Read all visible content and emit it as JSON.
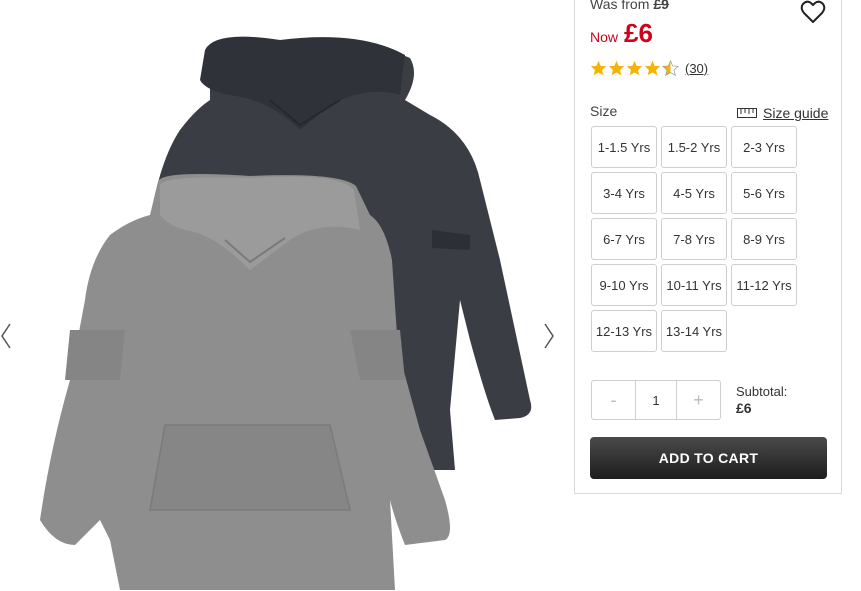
{
  "product": {
    "image_alt": "Two hooded long-sleeve tops: charcoal and grey",
    "was_label": "Was from",
    "was_price": "£9",
    "now_label": "Now",
    "now_price": "£6",
    "rating": 4.5,
    "review_count": "(30)"
  },
  "size_section": {
    "label": "Size",
    "guide_label": "Size guide",
    "options": [
      "1-1.5 Yrs",
      "1.5-2 Yrs",
      "2-3 Yrs",
      "3-4 Yrs",
      "4-5 Yrs",
      "5-6 Yrs",
      "6-7 Yrs",
      "7-8 Yrs",
      "8-9 Yrs",
      "9-10 Yrs",
      "10-11 Yrs",
      "11-12 Yrs",
      "12-13 Yrs",
      "13-14 Yrs"
    ]
  },
  "quantity": {
    "minus": "-",
    "value": "1",
    "plus": "+"
  },
  "subtotal": {
    "label": "Subtotal:",
    "amount": "£6"
  },
  "cart_button": "ADD TO CART",
  "icons": {
    "wishlist": "heart-outline-icon",
    "size_guide": "ruler-icon",
    "prev": "chevron-left-icon",
    "next": "chevron-right-icon",
    "star": "star-icon"
  },
  "colors": {
    "price_red": "#d0021b",
    "star_gold": "#f5b400",
    "cart_dark": "#1d1d1d"
  }
}
